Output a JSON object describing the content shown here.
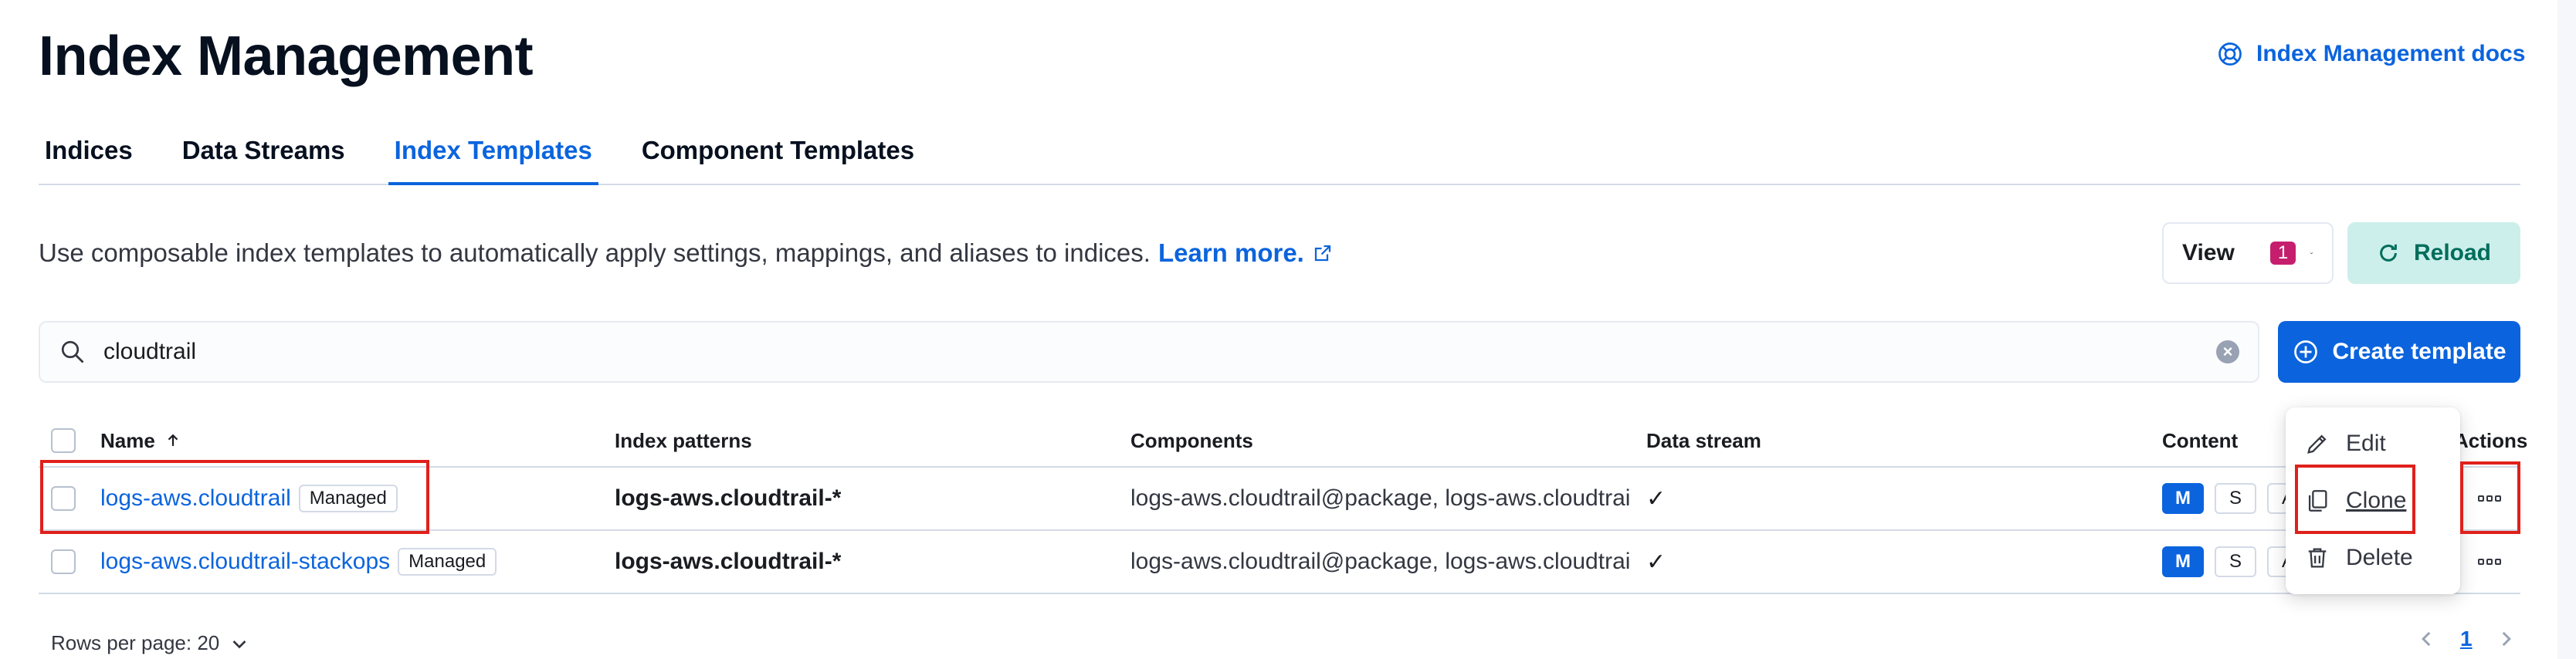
{
  "header": {
    "title": "Index Management",
    "docs_link": "Index Management docs"
  },
  "tabs": [
    {
      "label": "Indices",
      "active": false
    },
    {
      "label": "Data Streams",
      "active": false
    },
    {
      "label": "Index Templates",
      "active": true
    },
    {
      "label": "Component Templates",
      "active": false
    }
  ],
  "description": {
    "text": "Use composable index templates to automatically apply settings, mappings, and aliases to indices.",
    "learn_more": "Learn more."
  },
  "toolbar": {
    "view_label": "View",
    "view_badge": "1",
    "reload_label": "Reload",
    "create_label": "Create template"
  },
  "search": {
    "value": "cloudtrail"
  },
  "table": {
    "columns": {
      "name": "Name",
      "index_patterns": "Index patterns",
      "components": "Components",
      "data_stream": "Data stream",
      "content": "Content",
      "actions": "Actions"
    },
    "rows": [
      {
        "name": "logs-aws.cloudtrail",
        "badge": "Managed",
        "index_patterns": "logs-aws.cloudtrail-*",
        "components": "logs-aws.cloudtrail@package, logs-aws.cloudtrai",
        "data_stream": "✓",
        "content": [
          "M",
          "S",
          "A"
        ]
      },
      {
        "name": "logs-aws.cloudtrail-stackops",
        "badge": "Managed",
        "index_patterns": "logs-aws.cloudtrail-*",
        "components": "logs-aws.cloudtrail@package, logs-aws.cloudtrai",
        "data_stream": "✓",
        "content": [
          "M",
          "S",
          "A"
        ]
      }
    ]
  },
  "context_menu": {
    "items": [
      {
        "label": "Edit",
        "icon": "pencil-icon"
      },
      {
        "label": "Clone",
        "icon": "copy-icon"
      },
      {
        "label": "Delete",
        "icon": "trash-icon"
      }
    ]
  },
  "footer": {
    "rows_per_page": "Rows per page: 20",
    "page": "1"
  },
  "colors": {
    "primary": "#0b64dd",
    "reload_bg": "#ccefeb",
    "badge": "#c61e6e",
    "highlight": "#e0201b"
  }
}
